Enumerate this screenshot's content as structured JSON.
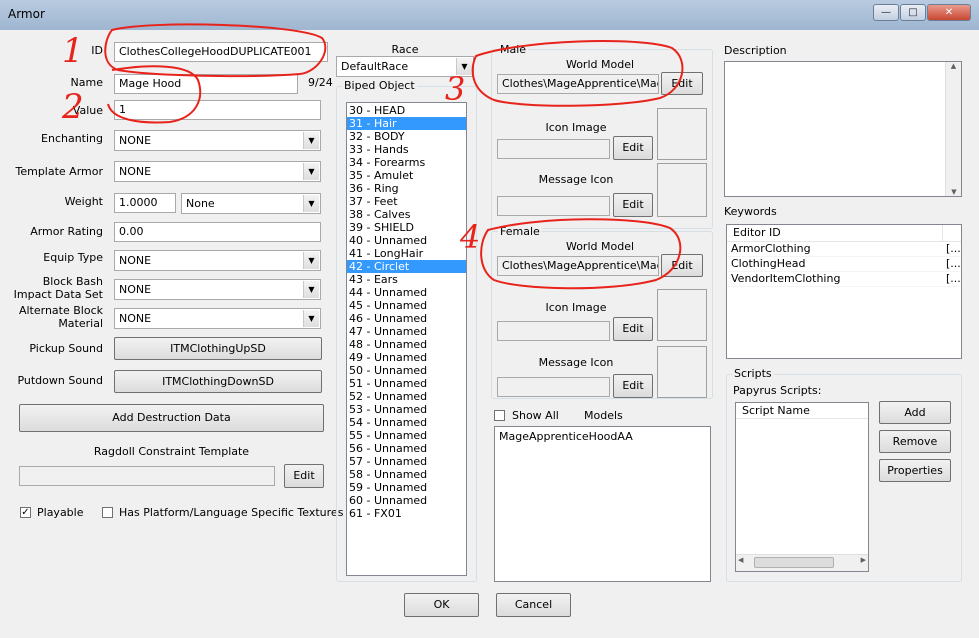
{
  "window": {
    "title": "Armor"
  },
  "left": {
    "id_label": "ID",
    "id_value": "ClothesCollegeHoodDUPLICATE001",
    "name_label": "Name",
    "name_value": "Mage Hood",
    "name_count": "9/24",
    "value_label": "Value",
    "value_value": "1",
    "enchanting_label": "Enchanting",
    "enchanting_value": "NONE",
    "template_label": "Template Armor",
    "template_value": "NONE",
    "weight_label": "Weight",
    "weight_value": "1.0000",
    "weight_unit": "None",
    "rating_label": "Armor Rating",
    "rating_value": "0.00",
    "equip_label": "Equip Type",
    "equip_value": "NONE",
    "block_label_1": "Block Bash",
    "block_label_2": "Impact Data Set",
    "block_value": "NONE",
    "alt_label_1": "Alternate Block",
    "alt_label_2": "Material",
    "alt_value": "NONE",
    "pickup_label": "Pickup Sound",
    "pickup_value": "ITMClothingUpSD",
    "putdown_label": "Putdown Sound",
    "putdown_value": "ITMClothingDownSD",
    "destruction_button": "Add Destruction Data",
    "ragdoll_label": "Ragdoll Constraint Template",
    "ragdoll_edit": "Edit",
    "playable_label": "Playable",
    "playable_checked": true,
    "platform_label": "Has Platform/Language Specific Textures",
    "platform_checked": false
  },
  "race": {
    "label": "Race",
    "value": "DefaultRace"
  },
  "biped": {
    "label": "Biped Object",
    "items": [
      {
        "text": "30 - HEAD",
        "selected": false
      },
      {
        "text": "31 - Hair",
        "selected": true
      },
      {
        "text": "32 - BODY",
        "selected": false
      },
      {
        "text": "33 - Hands",
        "selected": false
      },
      {
        "text": "34 - Forearms",
        "selected": false
      },
      {
        "text": "35 - Amulet",
        "selected": false
      },
      {
        "text": "36 - Ring",
        "selected": false
      },
      {
        "text": "37 - Feet",
        "selected": false
      },
      {
        "text": "38 - Calves",
        "selected": false
      },
      {
        "text": "39 - SHIELD",
        "selected": false
      },
      {
        "text": "40 - Unnamed",
        "selected": false
      },
      {
        "text": "41 - LongHair",
        "selected": false
      },
      {
        "text": "42 - Circlet",
        "selected": true
      },
      {
        "text": "43 - Ears",
        "selected": false
      },
      {
        "text": "44 - Unnamed",
        "selected": false
      },
      {
        "text": "45 - Unnamed",
        "selected": false
      },
      {
        "text": "46 - Unnamed",
        "selected": false
      },
      {
        "text": "47 - Unnamed",
        "selected": false
      },
      {
        "text": "48 - Unnamed",
        "selected": false
      },
      {
        "text": "49 - Unnamed",
        "selected": false
      },
      {
        "text": "50 - Unnamed",
        "selected": false
      },
      {
        "text": "51 - Unnamed",
        "selected": false
      },
      {
        "text": "52 - Unnamed",
        "selected": false
      },
      {
        "text": "53 - Unnamed",
        "selected": false
      },
      {
        "text": "54 - Unnamed",
        "selected": false
      },
      {
        "text": "55 - Unnamed",
        "selected": false
      },
      {
        "text": "56 - Unnamed",
        "selected": false
      },
      {
        "text": "57 - Unnamed",
        "selected": false
      },
      {
        "text": "58 - Unnamed",
        "selected": false
      },
      {
        "text": "59 - Unnamed",
        "selected": false
      },
      {
        "text": "60 - Unnamed",
        "selected": false
      },
      {
        "text": "61 - FX01",
        "selected": false
      }
    ]
  },
  "male": {
    "group": "Male",
    "world_model_label": "World Model",
    "world_model_value": "Clothes\\MageApprentice\\MageA",
    "edit": "Edit",
    "icon_label": "Icon Image",
    "message_label": "Message Icon"
  },
  "female": {
    "group": "Female",
    "world_model_label": "World Model",
    "world_model_value": "Clothes\\MageApprentice\\MageA",
    "edit": "Edit",
    "icon_label": "Icon Image",
    "message_label": "Message Icon"
  },
  "models": {
    "show_all": "Show All",
    "label": "Models",
    "items": [
      "MageApprenticeHoodAA"
    ]
  },
  "description": {
    "label": "Description"
  },
  "keywords": {
    "label": "Keywords",
    "column": "Editor ID",
    "items": [
      {
        "id": "ArmorClothing",
        "extra": "[..."
      },
      {
        "id": "ClothingHead",
        "extra": "[..."
      },
      {
        "id": "VendorItemClothing",
        "extra": "[..."
      }
    ]
  },
  "scripts": {
    "group": "Scripts",
    "label": "Papyrus Scripts:",
    "column": "Script Name",
    "add": "Add",
    "remove": "Remove",
    "properties": "Properties"
  },
  "footer": {
    "ok": "OK",
    "cancel": "Cancel"
  },
  "annotations": [
    "1",
    "2",
    "3",
    "4"
  ],
  "colors": {
    "selection": "#3399ff",
    "annotation": "#e8231b",
    "titlebar": "#a9bdd6"
  }
}
